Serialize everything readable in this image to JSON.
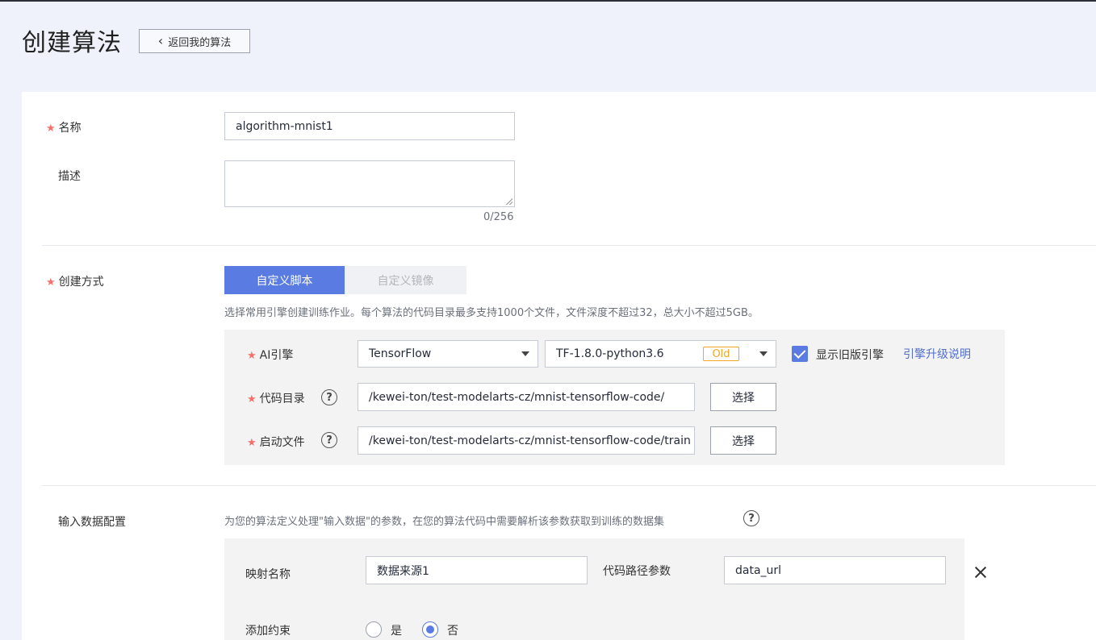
{
  "header": {
    "title": "创建算法",
    "back_label": "返回我的算法"
  },
  "form": {
    "name": {
      "label": "名称",
      "value": "algorithm-mnist1"
    },
    "description": {
      "label": "描述",
      "value": "",
      "counter": "0/256"
    },
    "creation_method": {
      "label": "创建方式",
      "options": [
        "自定义脚本",
        "自定义镜像"
      ],
      "selected": "自定义脚本",
      "hint": "选择常用引擎创建训练作业。每个算法的代码目录最多支持1000个文件，文件深度不超过32，总大小不超过5GB。"
    },
    "engine": {
      "label": "AI引擎",
      "framework": "TensorFlow",
      "version": "TF-1.8.0-python3.6",
      "version_badge": "Old",
      "show_old_label": "显示旧版引擎",
      "show_old_checked": true,
      "upgrade_link": "引擎升级说明"
    },
    "code_dir": {
      "label": "代码目录",
      "value": "/kewei-ton/test-modelarts-cz/mnist-tensorflow-code/",
      "button": "选择"
    },
    "boot_file": {
      "label": "启动文件",
      "value": "/kewei-ton/test-modelarts-cz/mnist-tensorflow-code/train",
      "button": "选择"
    },
    "input_data": {
      "label": "输入数据配置",
      "hint": "为您的算法定义处理\"输入数据\"的参数，在您的算法代码中需要解析该参数获取到训练的数据集",
      "mapping_name_label": "映射名称",
      "mapping_name_value": "数据来源1",
      "code_path_label": "代码路径参数",
      "code_path_value": "data_url",
      "constraint_label": "添加约束",
      "constraint_yes": "是",
      "constraint_no": "否",
      "constraint_selected": "否"
    }
  },
  "colors": {
    "accent": "#5a7ce2",
    "required": "#f66f6a",
    "badge": "#f5a623",
    "link": "#526ecc"
  }
}
